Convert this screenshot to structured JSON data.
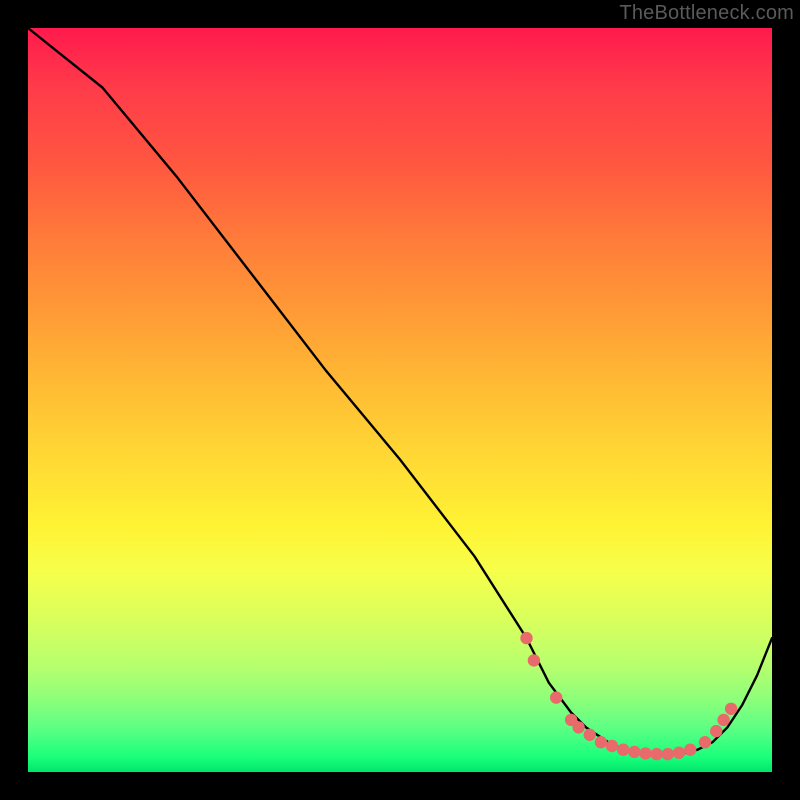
{
  "watermark": "TheBottleneck.com",
  "chart_data": {
    "type": "line",
    "title": "",
    "xlabel": "",
    "ylabel": "",
    "xlim": [
      0,
      100
    ],
    "ylim": [
      0,
      100
    ],
    "grid": false,
    "legend": false,
    "background": "rainbow-vertical",
    "series": [
      {
        "name": "bottleneck-curve",
        "x": [
          0,
          5,
          10,
          20,
          30,
          40,
          50,
          60,
          67,
          70,
          73,
          75,
          78,
          80,
          82,
          84,
          86,
          88,
          90,
          92,
          94,
          96,
          98,
          100
        ],
        "y": [
          100,
          96,
          92,
          80,
          67,
          54,
          42,
          29,
          18,
          12,
          8,
          6,
          4,
          3,
          2.5,
          2.3,
          2.3,
          2.5,
          3,
          4,
          6,
          9,
          13,
          18
        ]
      }
    ],
    "markers": {
      "name": "curve-dots",
      "color": "#e86a6a",
      "points": [
        {
          "x": 67,
          "y": 18
        },
        {
          "x": 68,
          "y": 15
        },
        {
          "x": 71,
          "y": 10
        },
        {
          "x": 73,
          "y": 7
        },
        {
          "x": 74,
          "y": 6
        },
        {
          "x": 75.5,
          "y": 5
        },
        {
          "x": 77,
          "y": 4
        },
        {
          "x": 78.5,
          "y": 3.5
        },
        {
          "x": 80,
          "y": 3
        },
        {
          "x": 81.5,
          "y": 2.7
        },
        {
          "x": 83,
          "y": 2.5
        },
        {
          "x": 84.5,
          "y": 2.4
        },
        {
          "x": 86,
          "y": 2.4
        },
        {
          "x": 87.5,
          "y": 2.6
        },
        {
          "x": 89,
          "y": 3
        },
        {
          "x": 91,
          "y": 4
        },
        {
          "x": 92.5,
          "y": 5.5
        },
        {
          "x": 93.5,
          "y": 7
        },
        {
          "x": 94.5,
          "y": 8.5
        }
      ]
    }
  }
}
